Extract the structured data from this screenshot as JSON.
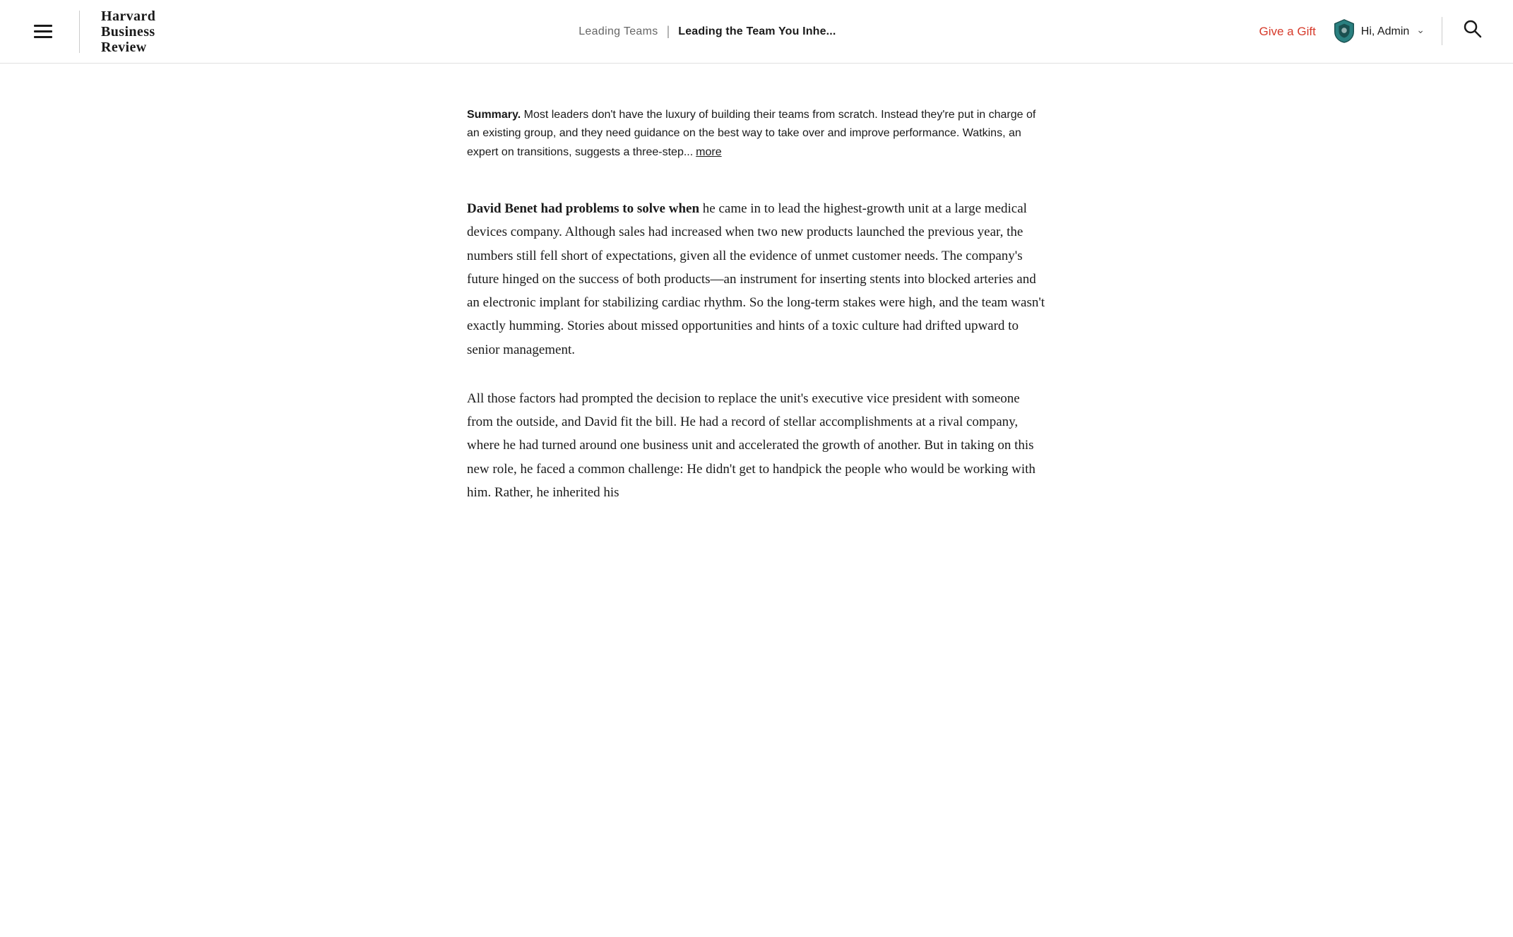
{
  "header": {
    "menu_icon_label": "Menu",
    "logo_line1": "Harvard",
    "logo_line2": "Business",
    "logo_line3": "Review",
    "breadcrumb_parent": "Leading Teams",
    "breadcrumb_separator": "|",
    "breadcrumb_current": "Leading the Team You Inhe...",
    "give_gift_label": "Give a Gift",
    "user_greeting": "Hi, Admin",
    "search_icon_label": "Search"
  },
  "summary": {
    "label": "Summary.",
    "text": " Most leaders don't have the luxury of building their teams from scratch. Instead they're put in charge of an existing group, and they need guidance on the best way to take over and improve performance. Watkins, an expert on transitions, suggests a three-step...",
    "more_label": "more"
  },
  "article": {
    "paragraph1_bold": "David Benet had problems to solve when",
    "paragraph1_rest": " he came in to lead the highest-growth unit at a large medical devices company. Although sales had increased when two new products launched the previous year, the numbers still fell short of expectations, given all the evidence of unmet customer needs. The company's future hinged on the success of both products—an instrument for inserting stents into blocked arteries and an electronic implant for stabilizing cardiac rhythm. So the long-term stakes were high, and the team wasn't exactly humming. Stories about missed opportunities and hints of a toxic culture had drifted upward to senior management.",
    "paragraph2": "All those factors had prompted the decision to replace the unit's executive vice president with someone from the outside, and David fit the bill. He had a record of stellar accomplishments at a rival company, where he had turned around one business unit and accelerated the growth of another. But in taking on this new role, he faced a common challenge: He didn't get to handpick the people who would be working with him. Rather, he inherited his"
  },
  "colors": {
    "accent_red": "#d63a2a",
    "shield_teal": "#2a7a7a",
    "shield_dark": "#1a4040"
  }
}
